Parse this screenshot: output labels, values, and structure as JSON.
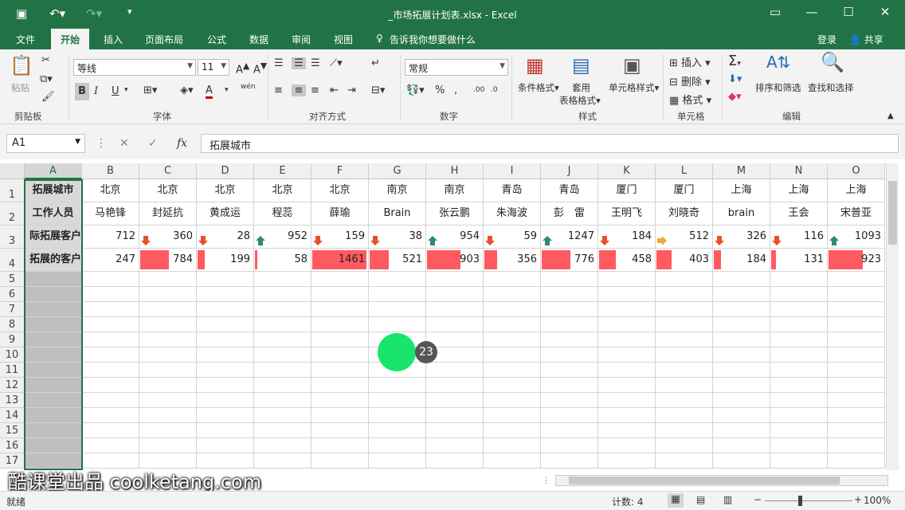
{
  "window": {
    "title": "_市场拓展计划表.xlsx - Excel",
    "sign_in": "登录",
    "share": "共享"
  },
  "menu": [
    "文件",
    "开始",
    "插入",
    "页面布局",
    "公式",
    "数据",
    "审阅",
    "视图"
  ],
  "tell_me": "告诉我你想要做什么",
  "ribbon": {
    "paste": "粘贴",
    "font_name": "等线",
    "font_size": "11",
    "number_format": "常规",
    "bold": "B",
    "italic": "I",
    "underline": "U",
    "wen": "wén",
    "cond_format": "条件格式",
    "table_format_1": "套用",
    "table_format_2": "表格格式",
    "cell_style": "单元格样式",
    "insert": "插入",
    "delete": "删除",
    "format": "格式",
    "sort_filter": "排序和筛选",
    "find_select": "查找和选择",
    "groups": [
      "剪贴板",
      "字体",
      "对齐方式",
      "数字",
      "样式",
      "单元格",
      "编辑"
    ]
  },
  "formula_bar": {
    "name_box": "A1",
    "fx": "fx",
    "content": "拓展城市"
  },
  "columns": [
    "A",
    "B",
    "C",
    "D",
    "E",
    "F",
    "G",
    "H",
    "I",
    "J",
    "K",
    "L",
    "M",
    "N",
    "O"
  ],
  "rows": [
    "1",
    "2",
    "3",
    "4",
    "5",
    "6",
    "7",
    "8",
    "9",
    "10",
    "11",
    "12",
    "13",
    "14",
    "15",
    "16",
    "17"
  ],
  "sheet": {
    "row1": [
      "拓展城市",
      "北京",
      "北京",
      "北京",
      "北京",
      "北京",
      "南京",
      "南京",
      "青岛",
      "青岛",
      "厦门",
      "厦门",
      "上海",
      "上海",
      "上海"
    ],
    "row2": [
      "工作人员",
      "马艳锋",
      "封延抗",
      "黄成运",
      "程蕊",
      "薛瑜",
      "Brain",
      "张云鹏",
      "朱海波",
      "彭　雷",
      "王明飞",
      "刘晓奇",
      "brain",
      "王会",
      "宋普亚"
    ],
    "row3_label": "际拓展客户",
    "row3": [
      {
        "v": "712",
        "icon": "none"
      },
      {
        "v": "360",
        "icon": "down"
      },
      {
        "v": "28",
        "icon": "down"
      },
      {
        "v": "952",
        "icon": "up"
      },
      {
        "v": "159",
        "icon": "down"
      },
      {
        "v": "38",
        "icon": "down"
      },
      {
        "v": "954",
        "icon": "up"
      },
      {
        "v": "59",
        "icon": "down"
      },
      {
        "v": "1247",
        "icon": "up"
      },
      {
        "v": "184",
        "icon": "down"
      },
      {
        "v": "512",
        "icon": "right"
      },
      {
        "v": "326",
        "icon": "down"
      },
      {
        "v": "116",
        "icon": "down"
      },
      {
        "v": "1093",
        "icon": "up"
      }
    ],
    "row4_label": "拓展的客户",
    "row4": [
      {
        "v": "247",
        "fill": 0
      },
      {
        "v": "784",
        "fill": 0.53
      },
      {
        "v": "199",
        "fill": 0.13
      },
      {
        "v": "58",
        "fill": 0.04
      },
      {
        "v": "1461",
        "fill": 1.0
      },
      {
        "v": "521",
        "fill": 0.36
      },
      {
        "v": "903",
        "fill": 0.62
      },
      {
        "v": "356",
        "fill": 0.24
      },
      {
        "v": "776",
        "fill": 0.53
      },
      {
        "v": "458",
        "fill": 0.31
      },
      {
        "v": "403",
        "fill": 0.28
      },
      {
        "v": "184",
        "fill": 0.13
      },
      {
        "v": "131",
        "fill": 0.09
      },
      {
        "v": "923",
        "fill": 0.63
      }
    ]
  },
  "badge": "23",
  "watermark": "酷课堂出品 coolketang.com",
  "status": {
    "ready": "就绪",
    "count": "计数: 4",
    "zoom": "100%"
  },
  "colors": {
    "accent": "#217346",
    "databar": "#ff5a5f",
    "arrow_down": "#e8502b",
    "arrow_up": "#2e8b6b",
    "arrow_right": "#f0a830"
  }
}
